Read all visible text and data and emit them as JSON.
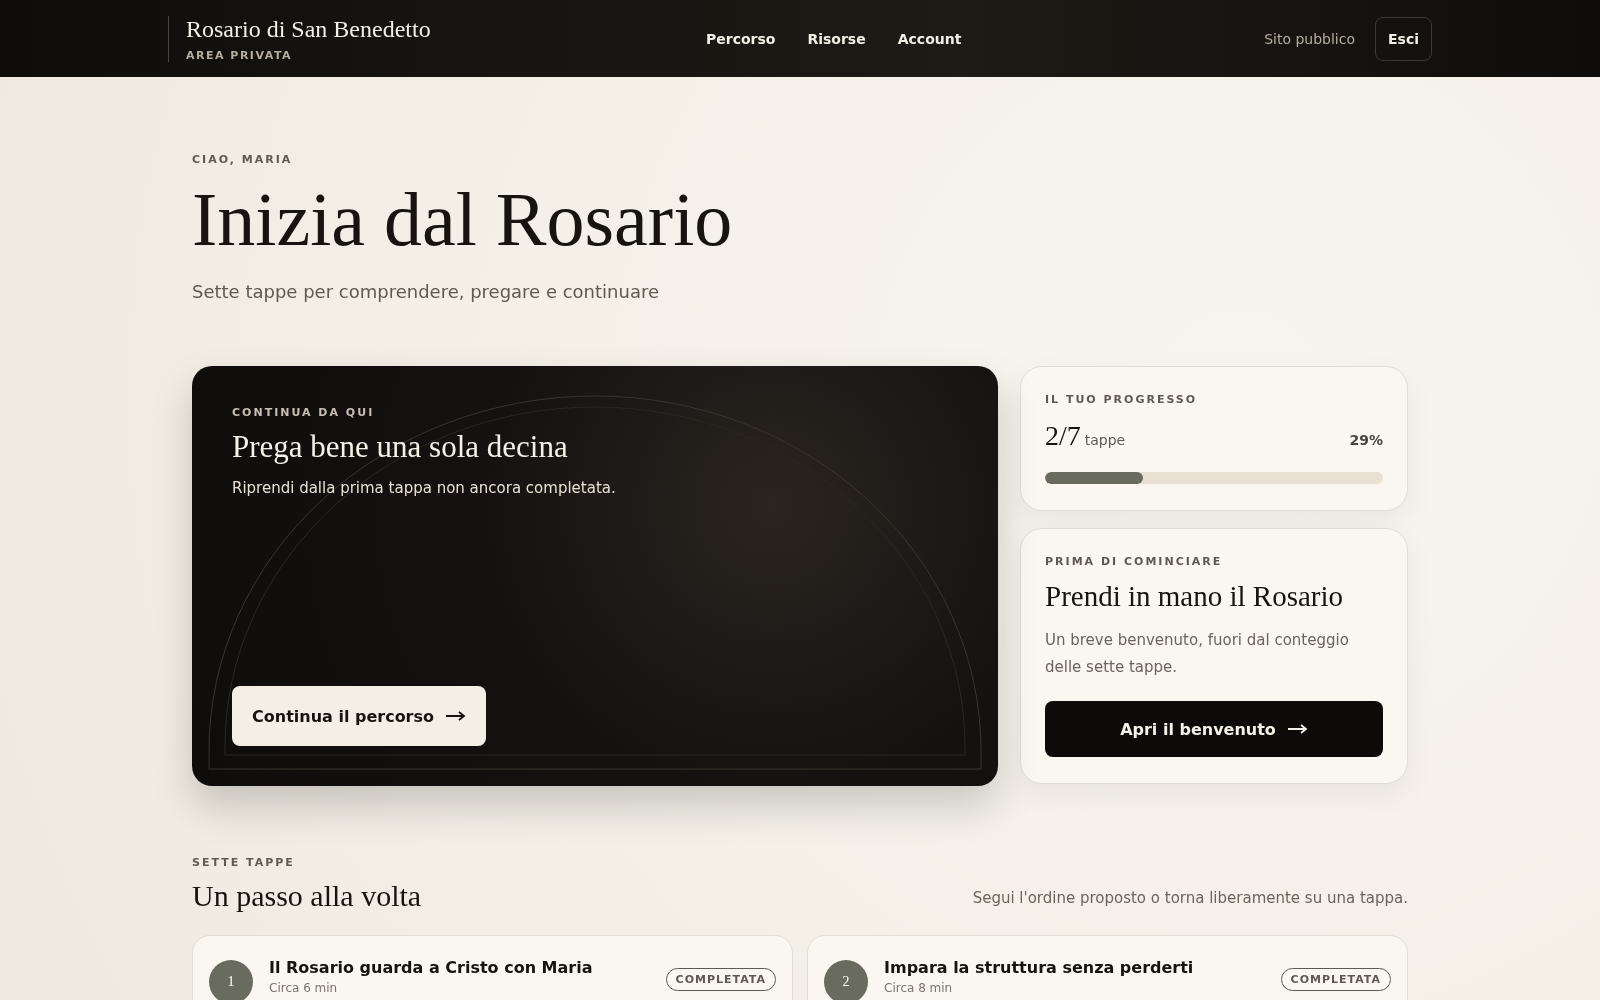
{
  "header": {
    "brand": "Rosario di San Benedetto",
    "subtitle": "AREA PRIVATA",
    "nav": [
      {
        "label": "Percorso"
      },
      {
        "label": "Risorse"
      },
      {
        "label": "Account"
      }
    ],
    "public_link": "Sito pubblico",
    "logout": "Esci"
  },
  "hero": {
    "greeting": "CIAO, MARIA",
    "title": "Inizia dal Rosario",
    "subtitle": "Sette tappe per comprendere, pregare e continuare"
  },
  "continue_card": {
    "eyebrow": "CONTINUA DA QUI",
    "title": "Prega bene una sola decina",
    "text": "Riprendi dalla prima tappa non ancora completata.",
    "button": "Continua il percorso"
  },
  "progress_card": {
    "eyebrow": "IL TUO PROGRESSO",
    "count": "2/7",
    "unit": "tappe",
    "percent": "29%",
    "level": 0.29
  },
  "welcome_card": {
    "eyebrow": "PRIMA DI COMINCIARE",
    "title": "Prendi in mano il Rosario",
    "text": "Un breve benvenuto, fuori dal conteggio delle sette tappe.",
    "button": "Apri il benvenuto"
  },
  "steps_section": {
    "eyebrow": "SETTE TAPPE",
    "title": "Un passo alla volta",
    "note": "Segui l'ordine proposto o torna liberamente su una tappa.",
    "steps": [
      {
        "number": "1",
        "title": "Il Rosario guarda a Cristo con Maria",
        "duration": "Circa 6 min",
        "badge": "COMPLETATA",
        "completed": true
      },
      {
        "number": "2",
        "title": "Impara la struttura senza perderti",
        "duration": "Circa 8 min",
        "badge": "COMPLETATA",
        "completed": true
      }
    ]
  }
}
